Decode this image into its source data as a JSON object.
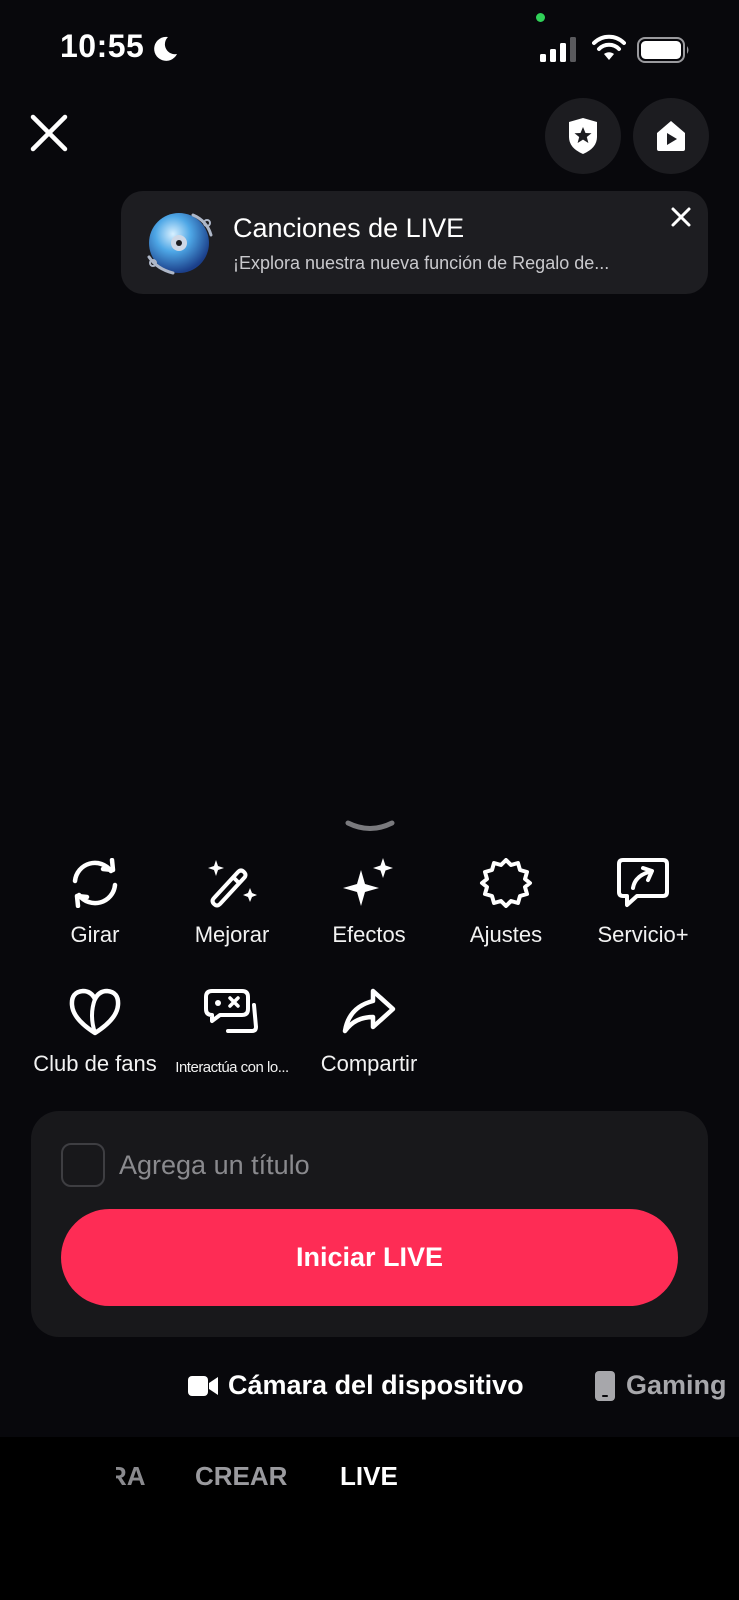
{
  "status_bar": {
    "time": "10:55"
  },
  "banner": {
    "title": "Canciones de LIVE",
    "subtitle": "¡Explora nuestra nueva función de Regalo de..."
  },
  "tools": [
    {
      "label": "Girar",
      "icon": "rotate-icon"
    },
    {
      "label": "Mejorar",
      "icon": "magic-wand-icon"
    },
    {
      "label": "Efectos",
      "icon": "sparkles-icon"
    },
    {
      "label": "Ajustes",
      "icon": "gear-icon"
    },
    {
      "label": "Servicio+",
      "icon": "share-screen-icon"
    },
    {
      "label": "Club de fans",
      "icon": "heart-icon"
    },
    {
      "label": "Interactúa con lo...",
      "icon": "game-controller-icon"
    },
    {
      "label": "Compartir",
      "icon": "share-arrow-icon"
    }
  ],
  "title_input": {
    "placeholder": "Agrega un título",
    "value": ""
  },
  "start_button": {
    "label": "Iniciar LIVE"
  },
  "colors": {
    "accent": "#fe2c55",
    "background": "#08080c",
    "card": "#18181b"
  },
  "sources": [
    {
      "label": "Cámara del dispositivo",
      "icon": "video-camera-icon",
      "selected": true
    },
    {
      "label": "Gaming",
      "icon": "phone-icon",
      "selected": false
    }
  ],
  "bottom_nav": {
    "items": [
      "RA",
      "CREAR",
      "LIVE"
    ],
    "selected": "LIVE"
  }
}
